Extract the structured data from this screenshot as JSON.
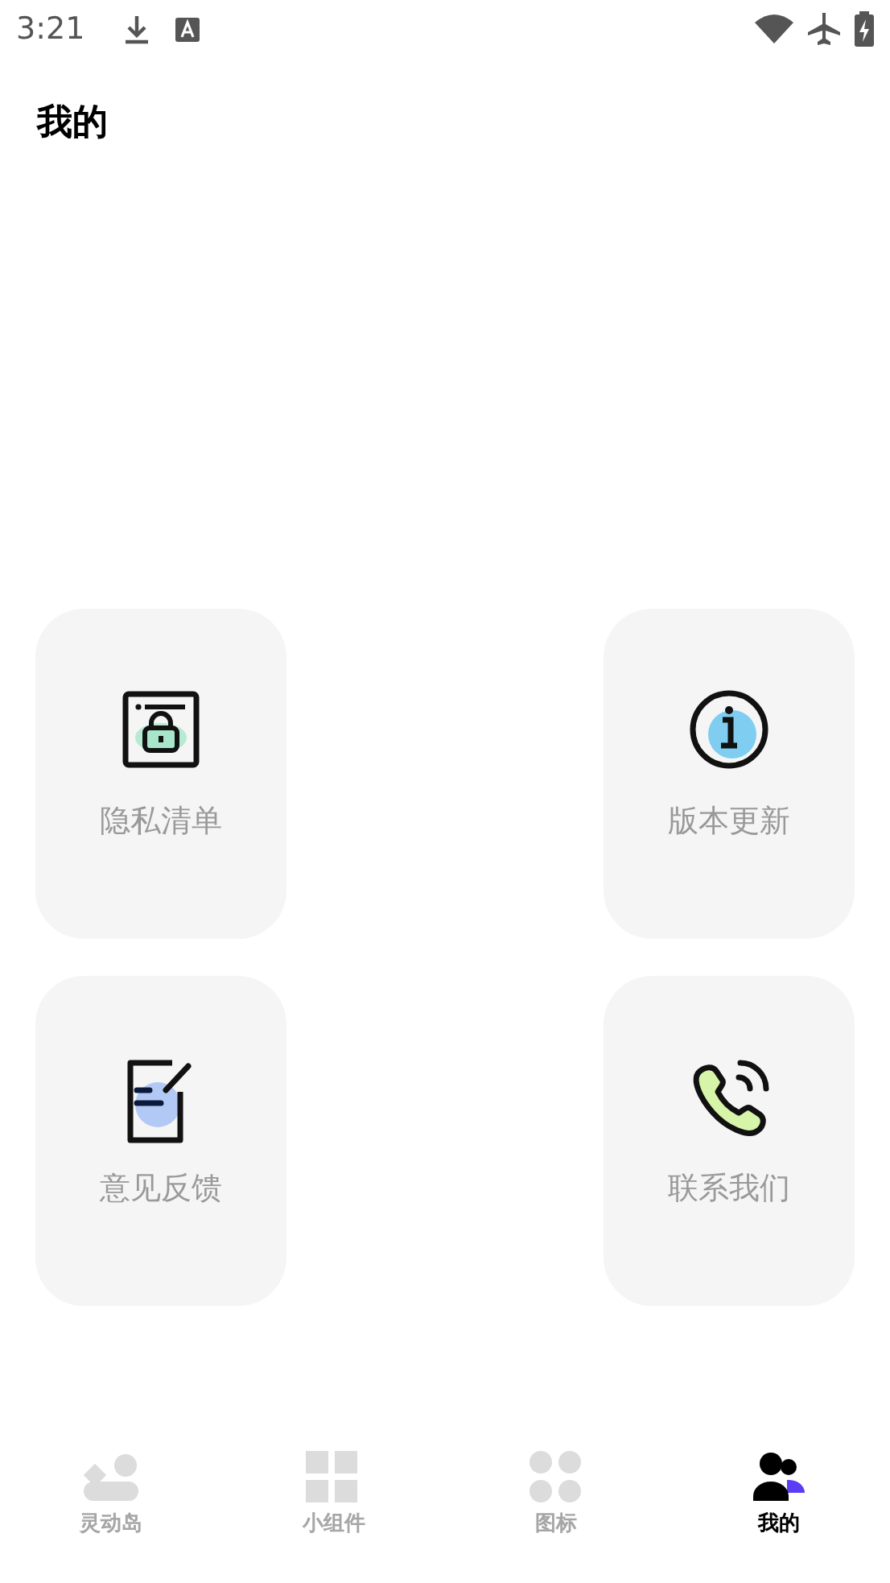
{
  "status_bar": {
    "time": "3:21"
  },
  "header": {
    "title": "我的"
  },
  "cards": [
    {
      "kind": "privacy",
      "label": "隐私清单"
    },
    {
      "kind": "info",
      "label": "版本更新"
    },
    {
      "kind": "feedback",
      "label": "意见反馈"
    },
    {
      "kind": "contact",
      "label": "联系我们"
    }
  ],
  "nav": [
    {
      "kind": "island",
      "label": "灵动岛",
      "selected": false
    },
    {
      "kind": "widgets",
      "label": "小组件",
      "selected": false
    },
    {
      "kind": "icons",
      "label": "图标",
      "selected": false
    },
    {
      "kind": "profile",
      "label": "我的",
      "selected": true
    }
  ]
}
